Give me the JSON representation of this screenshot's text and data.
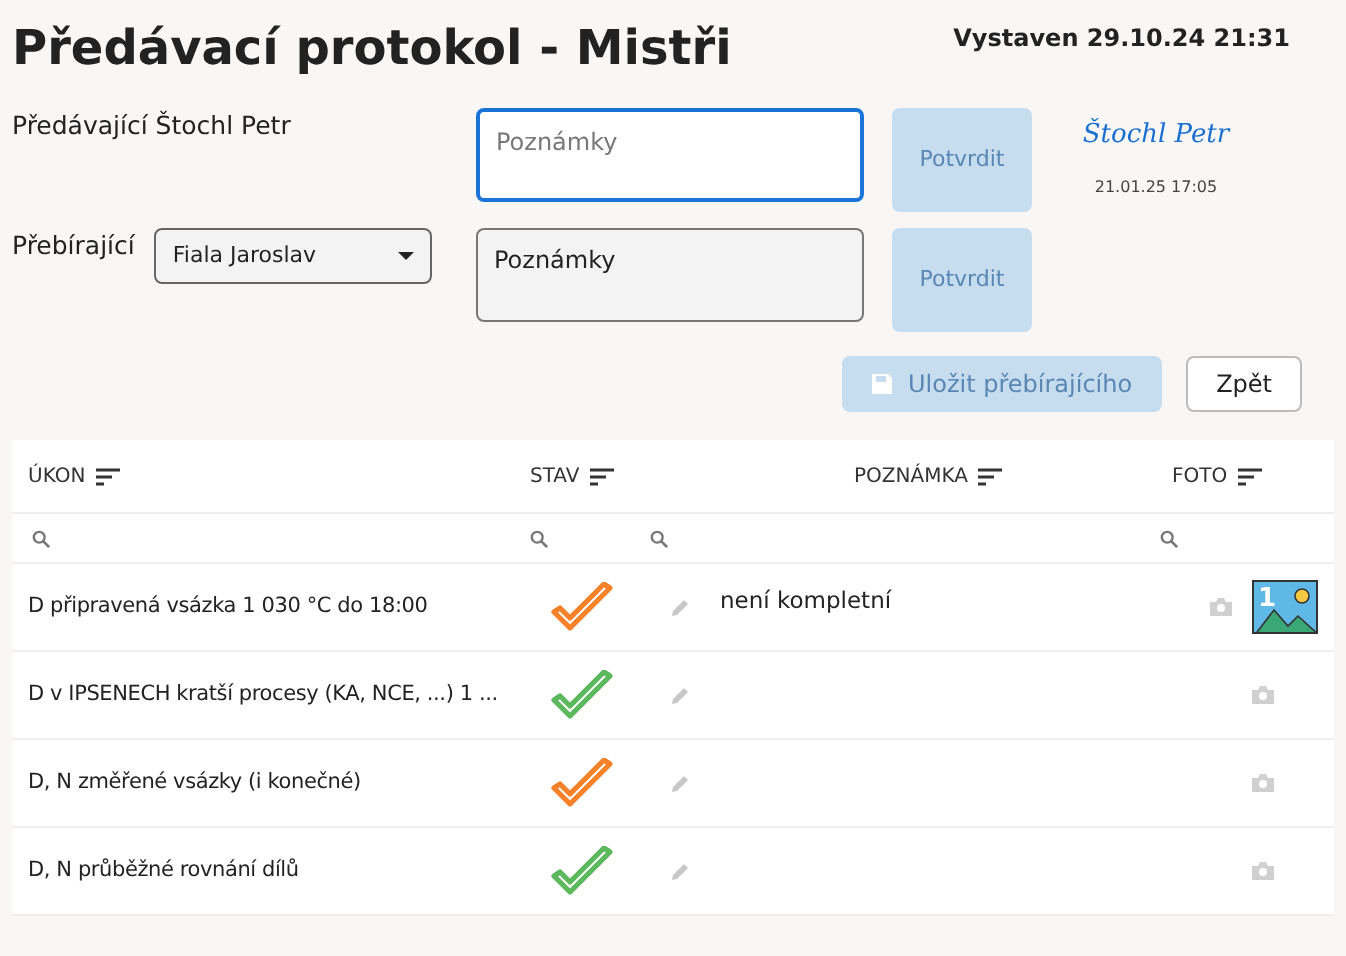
{
  "title": "Předávací protokol - Mistři",
  "issued": "Vystaven 29.10.24 21:31",
  "handover": {
    "label": "Předávající Štochl Petr",
    "notes": {
      "placeholder": "Poznámky",
      "focused": true
    },
    "confirm": "Potvrdit",
    "signature": "Štochl Petr",
    "signed_at": "21.01.25 17:05"
  },
  "receiver": {
    "label": "Přebírající",
    "select": "Fiala Jaroslav",
    "notes": {
      "value": "Poznámky",
      "focused": false
    },
    "confirm": "Potvrdit"
  },
  "buttons": [
    {
      "kind": "save",
      "label": "Uložit přebírajícího",
      "disabled": true
    },
    {
      "kind": "back",
      "label": "Zpět",
      "disabled": false
    }
  ],
  "table": {
    "columns": [
      "ÚKON",
      "STAV",
      "POZNÁMKA",
      "FOTO"
    ],
    "rows": [
      {
        "task": "D připravená vsázka 1 030 °C do 18:00",
        "color": "#f5822a",
        "note": "není kompletní",
        "photo_count": "1"
      },
      {
        "task": "D v IPSENECH kratší procesy (KA, NCE, ...) 1 ...",
        "color": "#5cb85c"
      },
      {
        "task": "D, N změřené vsázky (i konečné)",
        "color": "#f5822a"
      },
      {
        "task": "D, N průběžné rovnání dílů",
        "color": "#5cb85c"
      }
    ]
  }
}
